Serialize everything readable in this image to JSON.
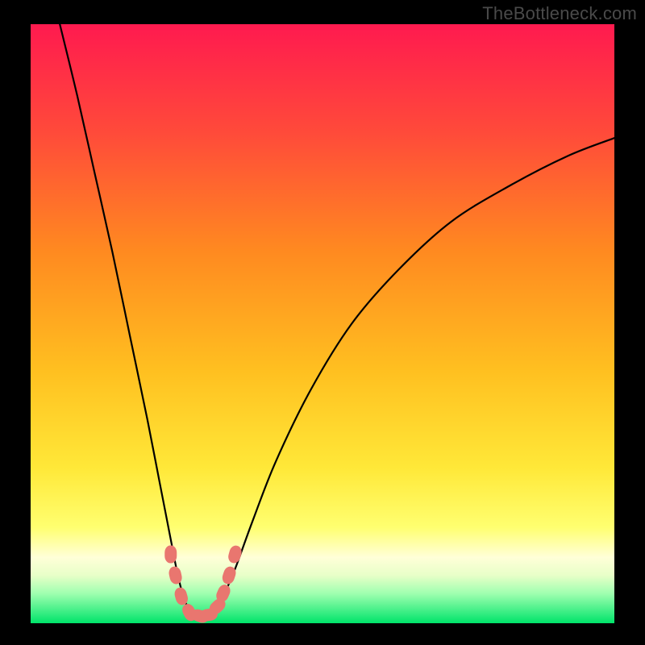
{
  "watermark": "TheBottleneck.com",
  "colors": {
    "black": "#000000",
    "gradient_top": "#ff1a4f",
    "gradient_mid1": "#ff6a2a",
    "gradient_mid2": "#ffb020",
    "gradient_mid3": "#ffe030",
    "gradient_pale": "#ffff9a",
    "gradient_pale2": "#f4ffb0",
    "gradient_green": "#00e46a",
    "curve": "#000000",
    "marker": "#e9766f"
  },
  "chart_data": {
    "type": "line",
    "title": "",
    "xlabel": "",
    "ylabel": "",
    "xlim": [
      0,
      100
    ],
    "ylim": [
      0,
      100
    ],
    "series": [
      {
        "name": "bottleneck-curve",
        "x": [
          5,
          8,
          11,
          14,
          17,
          20,
          22,
          24,
          25,
          26,
          27,
          28,
          29,
          30,
          31,
          32,
          33,
          35,
          38,
          42,
          48,
          55,
          63,
          72,
          82,
          92,
          100
        ],
        "y": [
          100,
          88,
          75,
          62,
          48,
          34,
          24,
          14,
          9,
          5,
          2.5,
          1.5,
          1.2,
          1.2,
          1.5,
          2.5,
          4.5,
          9,
          17,
          27,
          39,
          50,
          59,
          67,
          73,
          78,
          81
        ]
      }
    ],
    "markers": [
      {
        "x": 24.0,
        "y": 11.5
      },
      {
        "x": 24.8,
        "y": 8.0
      },
      {
        "x": 25.8,
        "y": 4.5
      },
      {
        "x": 27.2,
        "y": 1.8
      },
      {
        "x": 29.0,
        "y": 1.2
      },
      {
        "x": 30.5,
        "y": 1.4
      },
      {
        "x": 32.0,
        "y": 2.8
      },
      {
        "x": 33.0,
        "y": 5.0
      },
      {
        "x": 34.0,
        "y": 8.0
      },
      {
        "x": 35.0,
        "y": 11.5
      }
    ],
    "grid": false,
    "legend": false
  }
}
